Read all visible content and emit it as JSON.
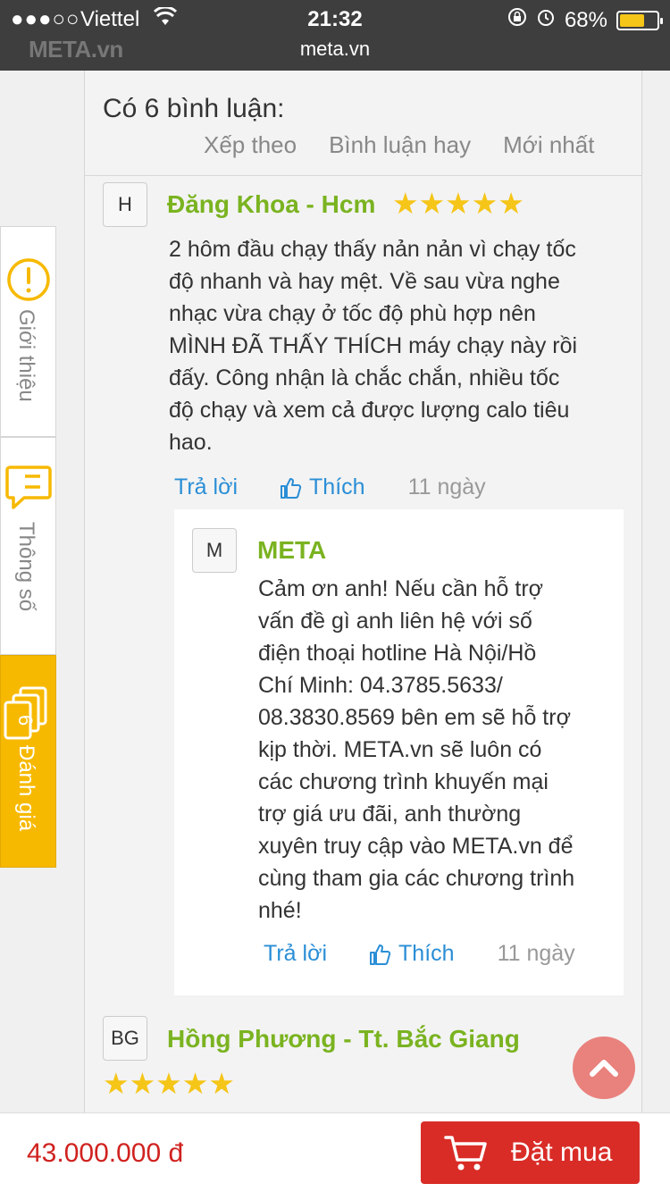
{
  "status_bar": {
    "signal": "●●●○○",
    "carrier": "Viettel",
    "time": "21:32",
    "battery_text": "68%",
    "battery_level": 0.68
  },
  "browser": {
    "brand_watermark": "META.vn",
    "url": "meta.vn"
  },
  "comments_section": {
    "count_title": "Có 6 bình luận:",
    "sort_label": "Xếp theo",
    "sort_options": [
      "Bình luận hay",
      "Mới nhất"
    ]
  },
  "comments": [
    {
      "avatar": "H",
      "author": "Đăng Khoa - Hcm",
      "stars": "★★★★★",
      "rating": 5,
      "lines": [
        "2 hôm đầu chạy thấy nản nản vì chạy tốc",
        "độ nhanh và hay mệt. Về sau vừa nghe",
        "nhạc vừa chạy ở tốc độ phù hợp nên",
        "MÌNH ĐÃ THẤY THÍCH máy chạy này rồi",
        "đấy. Công nhận là chắc chắn, nhiều tốc",
        "độ chạy và xem cả được lượng calo tiêu",
        "hao."
      ],
      "reply_label": "Trả lời",
      "like_label": "Thích",
      "time": "11 ngày"
    },
    {
      "avatar": "BG",
      "author": "Hồng Phương - Tt. Bắc Giang",
      "stars": "★★★★★",
      "rating": 5
    }
  ],
  "reply": {
    "avatar": "M",
    "author": "META",
    "lines": [
      "Cảm ơn anh! Nếu cần hỗ trợ",
      "vấn đề gì anh liên hệ với số",
      "điện thoại hotline Hà Nội/Hồ",
      "Chí Minh: 04.3785.5633/",
      "08.3830.8569 bên em sẽ hỗ trợ",
      "kịp thời. META.vn sẽ luôn có",
      "các chương trình khuyến mại",
      "trợ giá ưu đãi, anh thường",
      "xuyên truy cập vào META.vn để",
      "cùng tham gia các chương trình",
      "nhé!"
    ],
    "reply_label": "Trả lời",
    "like_label": "Thích",
    "time": "11 ngày"
  },
  "side_tabs": [
    {
      "label": "Giới thiệu",
      "icon": "info-icon"
    },
    {
      "label": "Thông số",
      "icon": "specs-icon"
    },
    {
      "label": "Đánh giá",
      "icon": "review-icon",
      "badge": "6",
      "active": true
    }
  ],
  "bottom_bar": {
    "price": "43.000.000 đ",
    "buy_label": "Đặt mua"
  },
  "colors": {
    "author_green": "#7ab320",
    "link_blue": "#2a8ed6",
    "star_yellow": "#f5c518",
    "tab_active": "#f7b900",
    "price_red": "#d0221f",
    "buy_red": "#d92c27"
  }
}
